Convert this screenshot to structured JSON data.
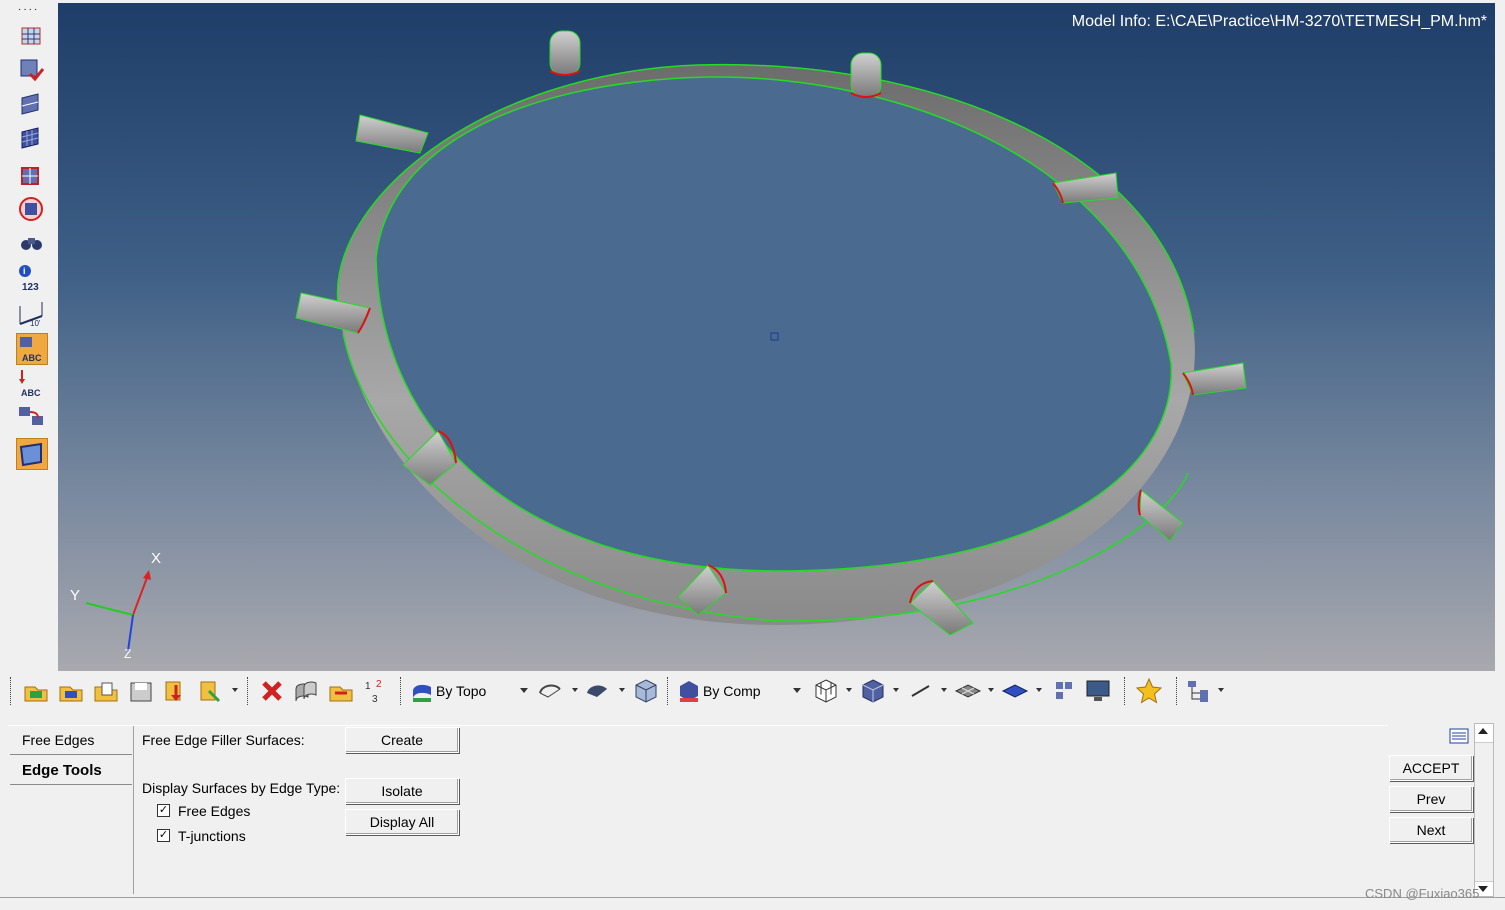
{
  "viewport": {
    "model_info": "Model Info: E:\\CAE\\Practice\\HM-3270\\TETMESH_PM.hm*",
    "triad": {
      "x": "X",
      "y": "Y",
      "z": "Z"
    }
  },
  "left_toolbar": {
    "icons": [
      "surface-edit-icon",
      "surface-delete-icon",
      "surface-split-icon",
      "surface-mesh-icon",
      "surface-select-icon",
      "surface-center-icon",
      "binoculars-icon",
      "info-123-icon",
      "measure-icon",
      "abc-label-icon",
      "abc-arrow-icon",
      "renumber-icon",
      "plane-icon"
    ],
    "info_label": "123",
    "measure_label": "10'",
    "abc_label": "ABC"
  },
  "toolbar": {
    "combo_topo": "By Topo",
    "combo_comp": "By Comp"
  },
  "panel": {
    "tabs": [
      "Free Edges",
      "Edge Tools"
    ],
    "active_tab": "Edge Tools",
    "filler_label": "Free Edge Filler Surfaces:",
    "create_label": "Create",
    "display_label": "Display Surfaces by Edge Type:",
    "isolate_label": "Isolate",
    "display_all_label": "Display All",
    "free_edges_label": "Free Edges",
    "tjunctions_label": "T-junctions",
    "free_edges_checked": true,
    "tjunctions_checked": true,
    "accept_label": "ACCEPT",
    "prev_label": "Prev",
    "next_label": "Next"
  },
  "watermark": "CSDN @Fuxiao365",
  "colors": {
    "free_edge": "#22dd22",
    "tjunction": "#dd1111",
    "accent": "#f0a020"
  }
}
